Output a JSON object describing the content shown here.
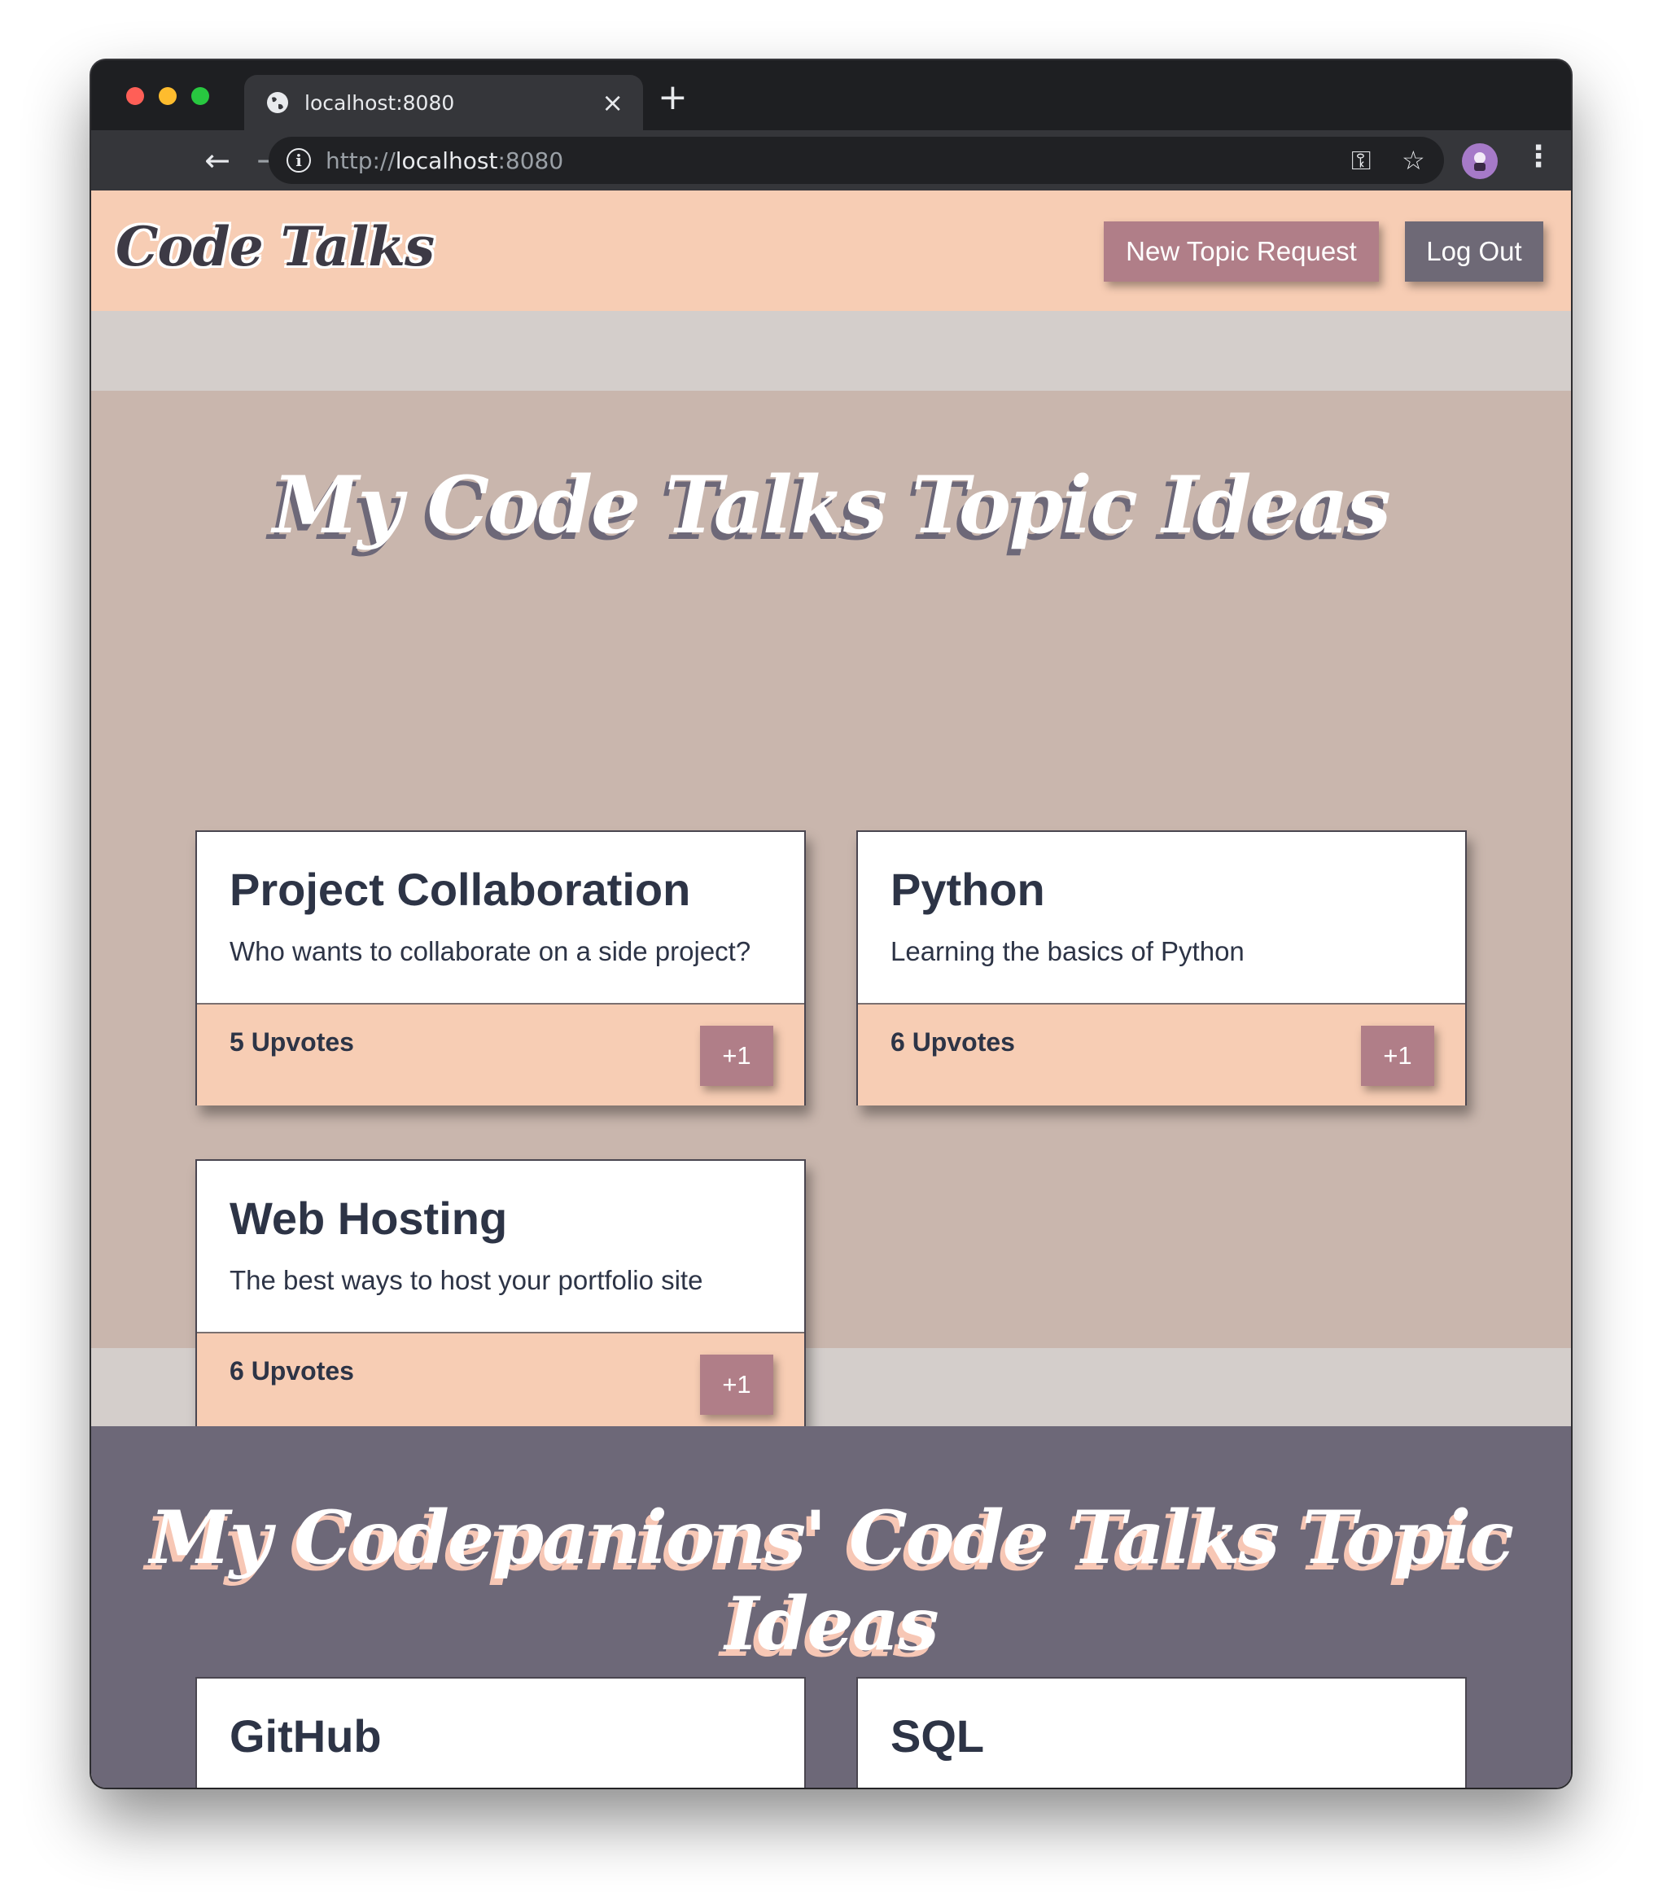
{
  "browser": {
    "tab_title": "localhost:8080",
    "tab_close": "×",
    "new_tab": "+",
    "url_scheme": "http://",
    "url_host": "localhost",
    "url_port": ":8080",
    "back": "←",
    "forward": "→",
    "reload": "↻",
    "key_icon": "⚿",
    "star_icon": "☆",
    "menu_icon": "⋮"
  },
  "header": {
    "logo": "Code Talks",
    "new_topic_label": "New Topic Request",
    "logout_label": "Log Out"
  },
  "my_topics": {
    "title": "My Code Talks Topic Ideas",
    "cards": [
      {
        "title": "Project Collaboration",
        "description": "Who wants to collaborate on a side project?",
        "upvotes": "5 Upvotes",
        "button": "+1"
      },
      {
        "title": "Python",
        "description": "Learning the basics of Python",
        "upvotes": "6 Upvotes",
        "button": "+1"
      },
      {
        "title": "Web Hosting",
        "description": "The best ways to host your portfolio site",
        "upvotes": "6 Upvotes",
        "button": "+1"
      }
    ]
  },
  "companion_topics": {
    "title": "My Codepanions' Code Talks Topic Ideas",
    "cards": [
      {
        "title": "GitHub"
      },
      {
        "title": "SQL"
      }
    ]
  },
  "colors": {
    "header_bg": "#f7cdb4",
    "mine_bg": "#c9b6ad",
    "others_bg": "#6d6878",
    "accent_button": "#b07e88",
    "logout_button": "#6e6976",
    "text_dark": "#2d3446"
  }
}
